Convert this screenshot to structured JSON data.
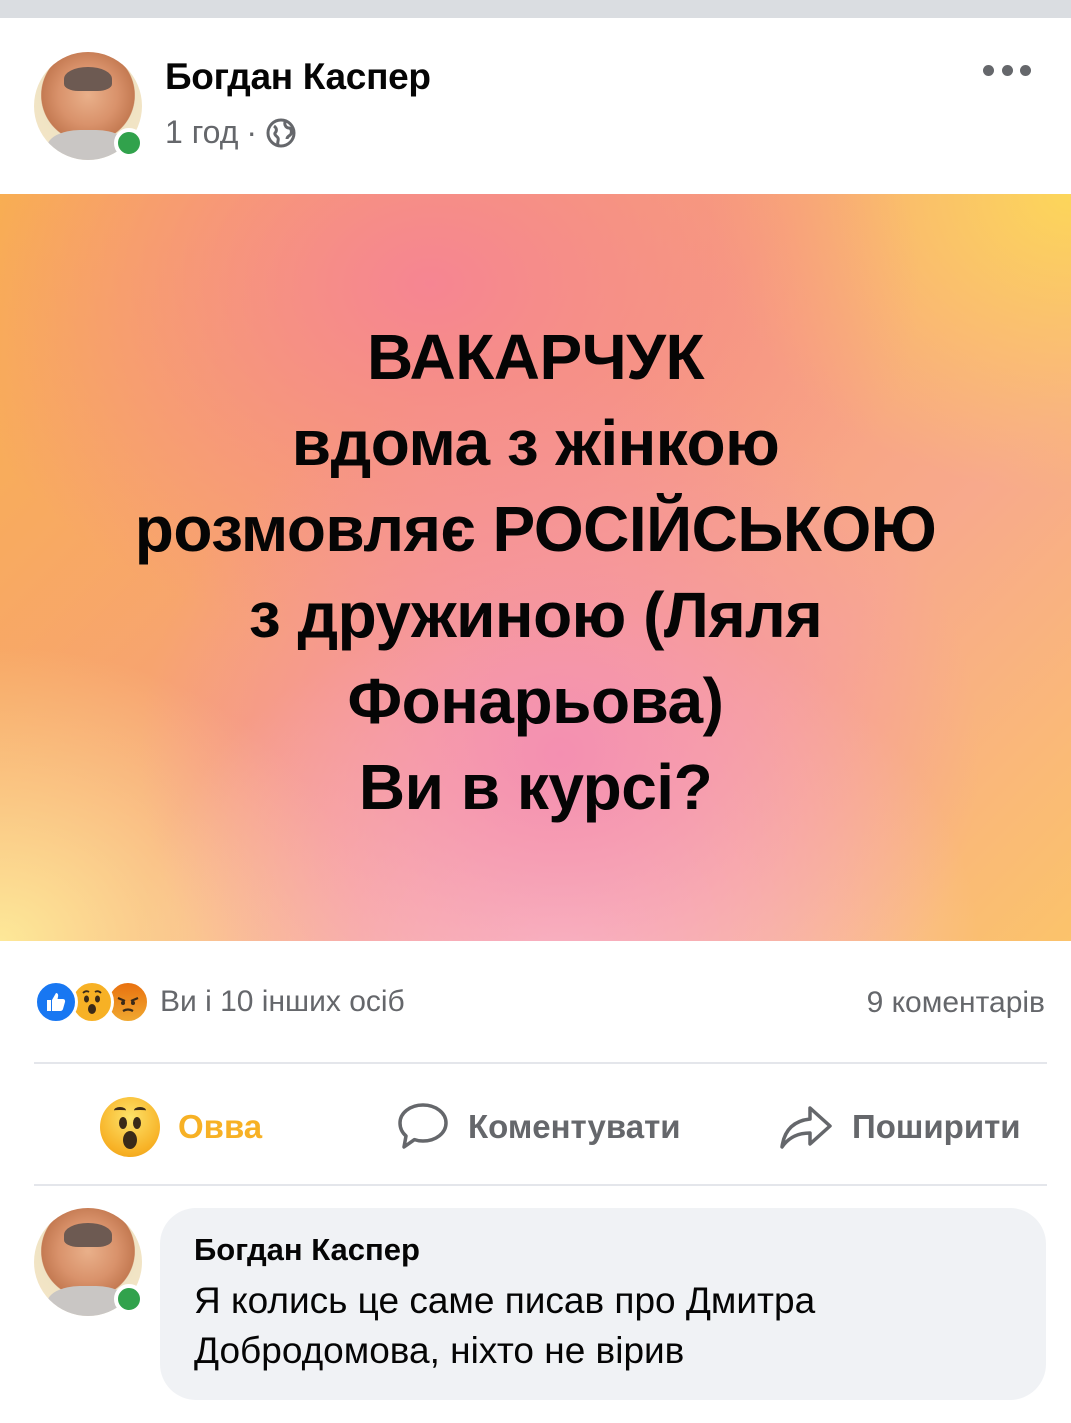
{
  "post": {
    "author": "Богдан Каспер",
    "time": "1 год",
    "meta_separator": "·",
    "privacy_icon": "globe-icon",
    "more_icon": "more-options-icon",
    "text_lines": [
      "ВАКАРЧУК",
      "вдома з жінкою",
      "розмовляє РОСІЙСЬКОЮ",
      "з дружиною (Ляля",
      "Фонарьова)",
      "Ви в курсі?"
    ]
  },
  "reactions": {
    "icons": [
      "like-reaction-icon",
      "wow-reaction-icon",
      "angry-reaction-icon"
    ],
    "summary": "Ви і 10 інших осіб",
    "comments": "9 коментарів"
  },
  "actions": {
    "wow_label": "Овва",
    "comment_label": "Коментувати",
    "share_label": "Поширити",
    "wow_color": "#f7b125",
    "muted_color": "#65676b"
  },
  "comment": {
    "author": "Богдан Каспер",
    "text": "Я колись це саме писав про Дмитра Добродомова, ніхто не вірив"
  },
  "colors": {
    "online": "#31a24c",
    "like_blue": "#1877f2"
  }
}
